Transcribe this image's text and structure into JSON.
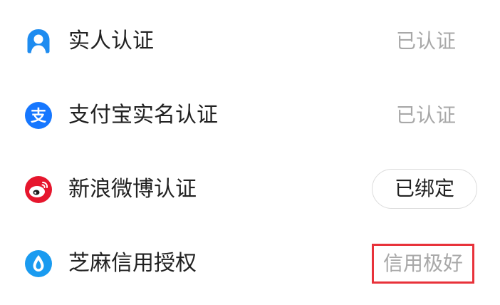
{
  "colors": {
    "background": "#ffffff",
    "text_primary": "#222222",
    "text_muted": "#a8a8a8",
    "realname_icon": "#1e8cf0",
    "alipay_icon": "#1677ff",
    "weibo_icon": "#e6162d",
    "zhima_icon": "#1a9bf0",
    "highlight_border": "#e8323a",
    "pill_border": "#dcdcdc"
  },
  "items": [
    {
      "label": "实人认证",
      "status": "已认证",
      "icon": "person-verify-icon"
    },
    {
      "label": "支付宝实名认证",
      "status": "已认证",
      "icon": "alipay-icon"
    },
    {
      "label": "新浪微博认证",
      "status": "已绑定",
      "icon": "weibo-icon"
    },
    {
      "label": "芝麻信用授权",
      "status": "信用极好",
      "icon": "zhima-credit-icon"
    }
  ]
}
